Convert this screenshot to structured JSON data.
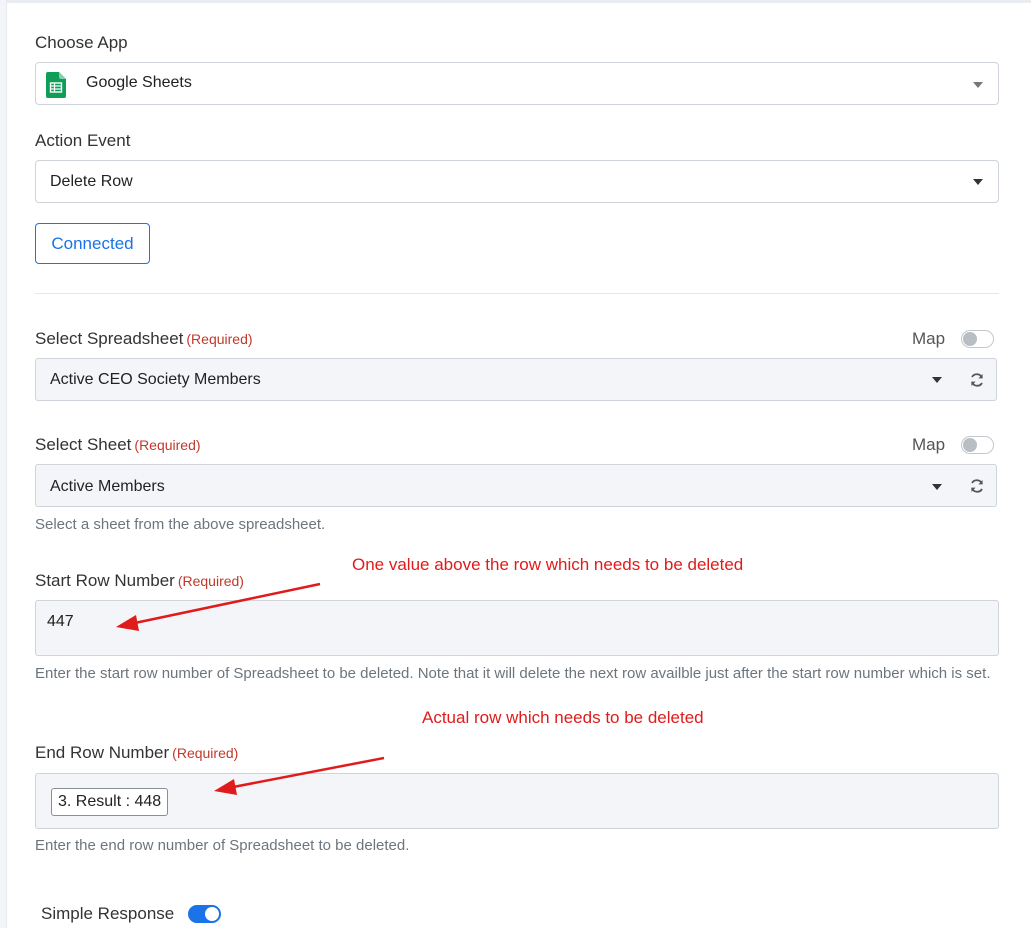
{
  "choose_app": {
    "label": "Choose App",
    "selected": "Google Sheets",
    "icon": "google-sheets-icon",
    "icon_color": "#0f9d58"
  },
  "action_event": {
    "label": "Action Event",
    "selected": "Delete Row"
  },
  "connected_button": "Connected",
  "select_spreadsheet": {
    "label": "Select Spreadsheet",
    "required": "(Required)",
    "map_label": "Map",
    "selected": "Active CEO Society Members"
  },
  "select_sheet": {
    "label": "Select Sheet",
    "required": "(Required)",
    "map_label": "Map",
    "selected": "Active Members",
    "help": "Select a sheet from the above spreadsheet."
  },
  "start_row": {
    "label": "Start Row Number",
    "required": "(Required)",
    "value": "447",
    "help": "Enter the start row number of Spreadsheet to be deleted. Note that it will delete the next row availble just after the start row number which is set.",
    "annotation": "One value above the row which needs to be deleted"
  },
  "end_row": {
    "label": "End Row Number",
    "required": "(Required)",
    "chip": "3. Result : 448",
    "help": "Enter the end row number of Spreadsheet to be deleted.",
    "annotation": "Actual row which needs to be deleted"
  },
  "simple_response": {
    "label": "Simple Response"
  },
  "colors": {
    "accent": "#1a73e8",
    "required": "#c0392b",
    "annotation": "#e01b1b"
  }
}
